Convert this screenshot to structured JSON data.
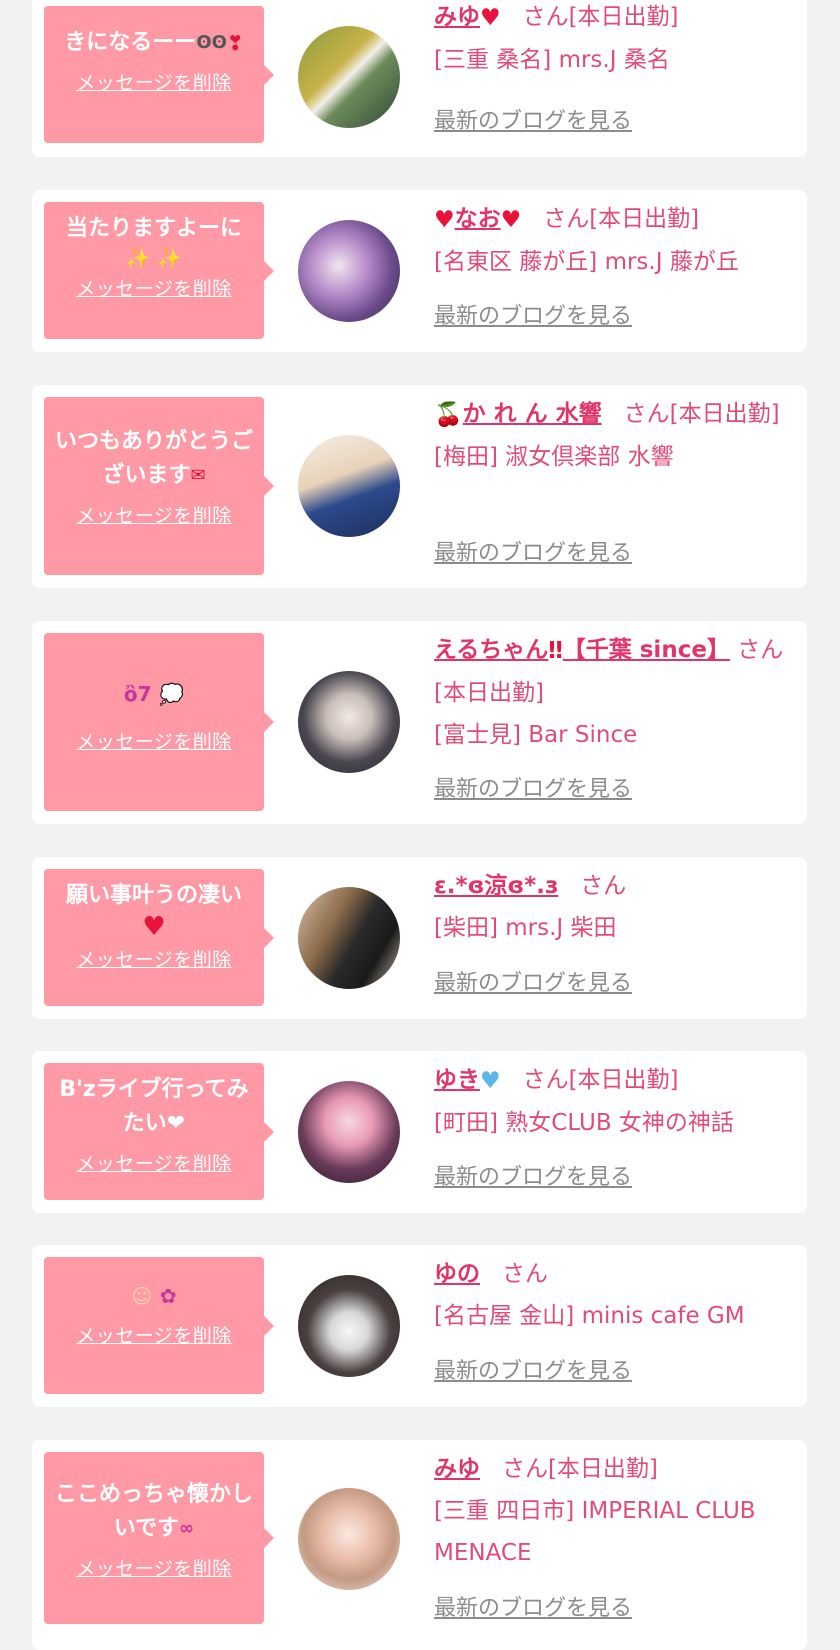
{
  "delete_label": "メッセージを削除",
  "blog_label": "最新のブログを見る",
  "san_label": "さん",
  "colors": {
    "background": "#f2f2f2",
    "bubble": "#fe99a5",
    "name": "#e0356b",
    "shop": "#e04c7a",
    "link": "#8c8c8c"
  },
  "cards": [
    {
      "message": "きになるーー",
      "name": "みゆ",
      "status": "[本日出勤]",
      "shop": "[三重 桑名] mrs.J 桑名",
      "icons": [
        "eyes-icon",
        "hearts-icon",
        "heart-icon"
      ]
    },
    {
      "message": "当たりますよーに",
      "name": "なお",
      "status": "[本日出勤]",
      "shop": "[名東区 藤が丘] mrs.J 藤が丘",
      "icons": [
        "sparkle-icon",
        "heart-icon"
      ]
    },
    {
      "message": "いつもありがとうございます",
      "name": "か れ ん  水響",
      "status": "[本日出勤]",
      "shop": "[梅田] 淑女倶楽部 水響",
      "icons": [
        "love-letter-icon",
        "cherry-icon"
      ]
    },
    {
      "message": "",
      "name": "えるちゃん",
      "name_suffix": "【千葉 since】",
      "status": "[本日出勤]",
      "shop": "[富士見] Bar Since",
      "icons": [
        "rabbit-icon",
        "speech-bubble-icon",
        "double-exclamation-icon"
      ]
    },
    {
      "message": "願い事叶うの凄い",
      "name": "ε.*ɞ涼ɞ*.з",
      "status": "",
      "shop": "[柴田] mrs.J 柴田",
      "icons": [
        "heart-icon"
      ]
    },
    {
      "message": "B'zライブ行ってみたい❤",
      "name": "ゆき",
      "status": "[本日出勤]",
      "shop": "[町田] 熟女CLUB 女神の神話",
      "icons": [
        "blue-heart-icon"
      ]
    },
    {
      "message": "",
      "name": "ゆの",
      "status": "",
      "shop": "[名古屋 金山] minis cafe GM",
      "icons": [
        "baby-icon",
        "flower-icon"
      ]
    },
    {
      "message": "ここめっちゃ懐かしいです",
      "name": "みゆ",
      "status": "[本日出勤]",
      "shop": "[三重 四日市] IMPERIAL CLUB MENACE",
      "icons": [
        "ribbon-icon"
      ]
    }
  ]
}
